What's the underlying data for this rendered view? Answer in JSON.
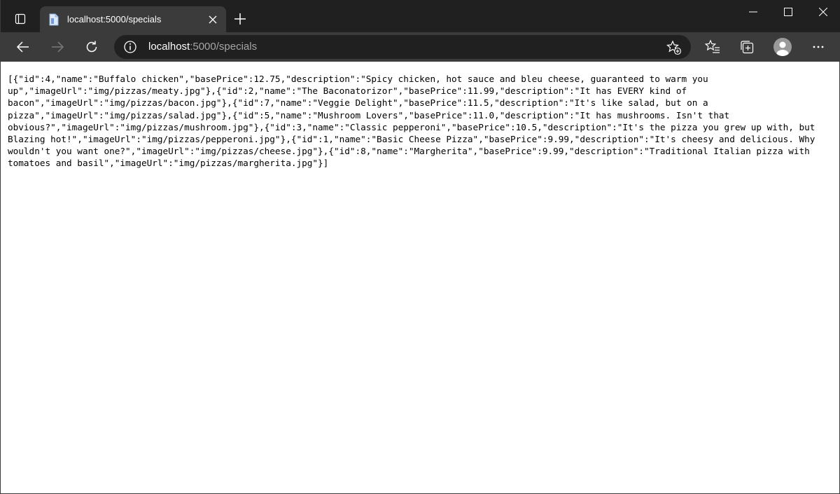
{
  "browser": {
    "tab": {
      "title": "localhost:5000/specials"
    },
    "address_bar": {
      "host": "localhost",
      "path": ":5000/specials"
    },
    "icons": {
      "tab_actions": "tab-actions-icon",
      "favicon": "page-favicon-icon",
      "close_tab": "close-icon",
      "new_tab": "plus-icon",
      "minimize": "minimize-icon",
      "maximize": "maximize-icon",
      "close_window": "close-icon",
      "back": "back-arrow-icon",
      "forward": "forward-arrow-icon",
      "refresh": "refresh-icon",
      "site_info": "info-icon",
      "add_favorite": "star-plus-icon",
      "favorites": "favorites-icon",
      "collections": "collections-icon",
      "profile": "profile-avatar",
      "menu": "more-icon"
    },
    "colors": {
      "tab_strip": "#202020",
      "toolbar": "#3b3b3b",
      "active_tab": "#3b3b3b",
      "address_field": "#202020",
      "page_background": "#ffffff"
    }
  },
  "page": {
    "json_text": "[{\"id\":4,\"name\":\"Buffalo chicken\",\"basePrice\":12.75,\"description\":\"Spicy chicken, hot sauce and bleu cheese, guaranteed to warm you up\",\"imageUrl\":\"img/pizzas/meaty.jpg\"},{\"id\":2,\"name\":\"The Baconatorizor\",\"basePrice\":11.99,\"description\":\"It has EVERY kind of bacon\",\"imageUrl\":\"img/pizzas/bacon.jpg\"},{\"id\":7,\"name\":\"Veggie Delight\",\"basePrice\":11.5,\"description\":\"It's like salad, but on a pizza\",\"imageUrl\":\"img/pizzas/salad.jpg\"},{\"id\":5,\"name\":\"Mushroom Lovers\",\"basePrice\":11.0,\"description\":\"It has mushrooms. Isn't that obvious?\",\"imageUrl\":\"img/pizzas/mushroom.jpg\"},{\"id\":3,\"name\":\"Classic pepperoni\",\"basePrice\":10.5,\"description\":\"It's the pizza you grew up with, but Blazing hot!\",\"imageUrl\":\"img/pizzas/pepperoni.jpg\"},{\"id\":1,\"name\":\"Basic Cheese Pizza\",\"basePrice\":9.99,\"description\":\"It's cheesy and delicious. Why wouldn't you want one?\",\"imageUrl\":\"img/pizzas/cheese.jpg\"},{\"id\":8,\"name\":\"Margherita\",\"basePrice\":9.99,\"description\":\"Traditional Italian pizza with tomatoes and basil\",\"imageUrl\":\"img/pizzas/margherita.jpg\"}]"
  }
}
